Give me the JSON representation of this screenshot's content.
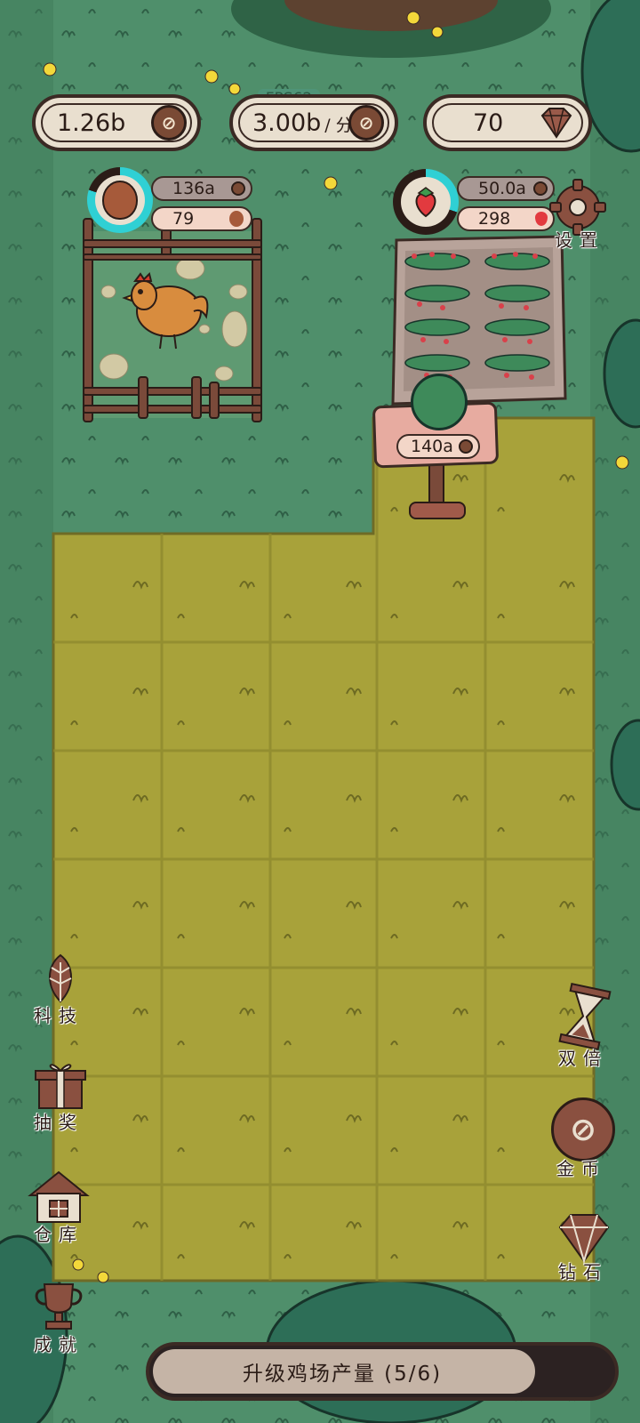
{
  "top_bar": {
    "fps_label": "FPS62",
    "coins": {
      "value": "1.26b",
      "icon": "coin-icon"
    },
    "rate": {
      "value": "3.00b",
      "unit": "/ 分",
      "icon": "coin-icon"
    },
    "diamonds": {
      "value": "70",
      "icon": "diamond-icon"
    }
  },
  "chicken_coop": {
    "price": "136a",
    "eggs": "79",
    "icon": "egg-icon"
  },
  "strawberry_field": {
    "price": "50.0a",
    "berries": "298",
    "icon": "strawberry-icon"
  },
  "sign": {
    "price": "140a"
  },
  "settings": {
    "label": "设置",
    "icon": "gear-icon"
  },
  "left_menu": [
    {
      "label": "科技",
      "icon": "leaf-icon"
    },
    {
      "label": "抽奖",
      "icon": "gift-icon"
    },
    {
      "label": "仓库",
      "icon": "house-icon"
    },
    {
      "label": "成就",
      "icon": "trophy-icon"
    }
  ],
  "right_menu": [
    {
      "label": "双倍",
      "icon": "hourglass-icon"
    },
    {
      "label": "金币",
      "icon": "coin-icon"
    },
    {
      "label": "钻石",
      "icon": "diamond-icon"
    }
  ],
  "progress": {
    "label": "升级鸡场产量 (5/6)",
    "fraction": 0.8333
  },
  "colors": {
    "grass": "#4f8f6b",
    "field": "#a8a23a",
    "panel": "#e9dfcf",
    "outline": "#3b2a24"
  }
}
